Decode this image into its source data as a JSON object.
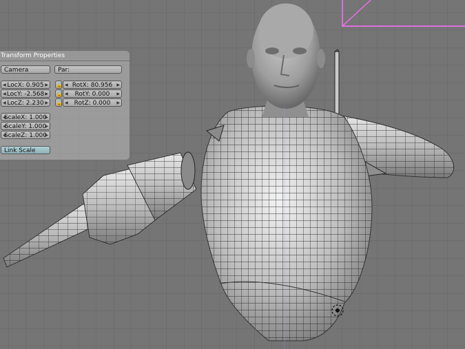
{
  "panel": {
    "title": "Transform Properties",
    "object_name": "Camera",
    "parent_label": "Par:",
    "loc_x": "LocX: 0.905",
    "loc_y": "LocY: -2.568",
    "loc_z": "LocZ: 2.230",
    "rot_x": "RotX: 80.956",
    "rot_y": "RotY: 0.000",
    "rot_z": "RotZ: 0.000",
    "scale_x": "ScaleX: 1.000",
    "scale_y": "ScaleY: 1.000",
    "scale_z": "ScaleZ: 1.000",
    "link_scale": "Link Scale",
    "lock_icon": "padlock-icon",
    "arrow_left_icon": "arrow-left-icon",
    "arrow_right_icon": "arrow-right-icon"
  },
  "viewport": {
    "background_color": "#757575",
    "grid_color": "#6a6a6a",
    "mesh_color": "#b8b8b8",
    "wire_color": "#2a2a2a",
    "selection_color": "#ff6eff",
    "icons": [
      "3d-cursor-icon"
    ]
  }
}
